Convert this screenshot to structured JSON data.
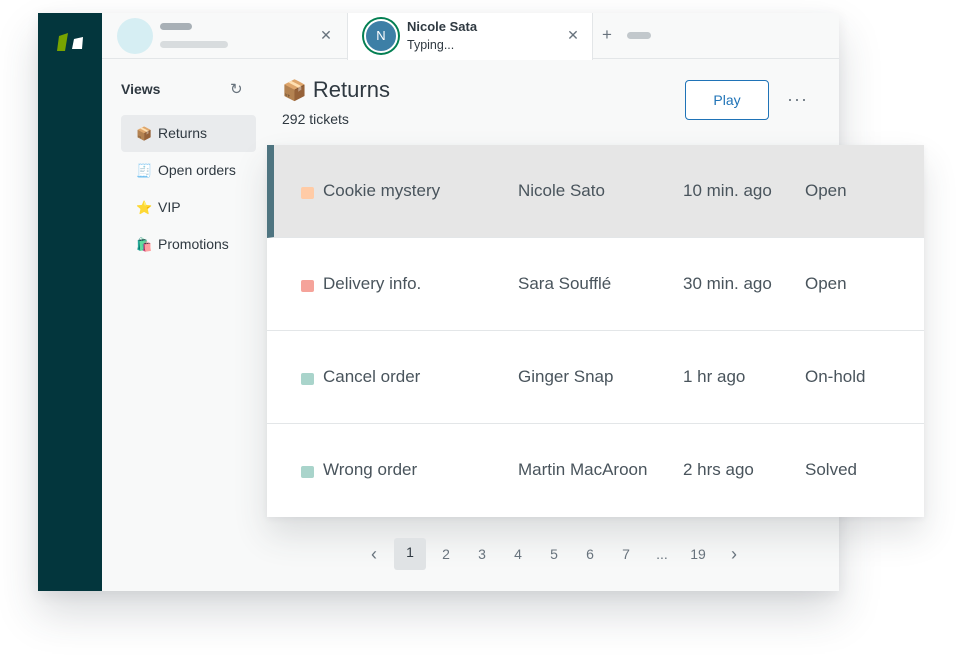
{
  "tabs": [
    {
      "placeholder": true
    },
    {
      "avatar_initial": "N",
      "name": "Nicole Sata",
      "status": "Typing..."
    }
  ],
  "sidebar": {
    "title": "Views",
    "items": [
      {
        "emoji": "📦",
        "label": "Returns",
        "active": true
      },
      {
        "emoji": "🧾",
        "label": "Open orders",
        "active": false
      },
      {
        "emoji": "⭐",
        "label": "VIP",
        "active": false
      },
      {
        "emoji": "🛍️",
        "label": "Promotions",
        "active": false
      }
    ]
  },
  "main": {
    "title_emoji": "📦",
    "title": "Returns",
    "ticket_count": "292 tickets",
    "play_label": "Play",
    "more_label": "···"
  },
  "tickets": [
    {
      "subject": "Cookie mystery",
      "requester": "Nicole Sato",
      "updated": "10 min. ago",
      "status": "Open",
      "priority_color": "#ffcba6",
      "selected": true
    },
    {
      "subject": "Delivery info.",
      "requester": "Sara Soufflé",
      "updated": "30 min. ago",
      "status": "Open",
      "priority_color": "#f5a39a",
      "selected": false
    },
    {
      "subject": "Cancel order",
      "requester": "Ginger Snap",
      "updated": "1 hr ago",
      "status": "On-hold",
      "priority_color": "#a9d4cb",
      "selected": false
    },
    {
      "subject": "Wrong order",
      "requester": "Martin MacAroon",
      "updated": "2 hrs ago",
      "status": "Solved",
      "priority_color": "#a9d4cb",
      "selected": false
    }
  ],
  "pagination": {
    "prev": "‹",
    "pages": [
      "1",
      "2",
      "3",
      "4",
      "5",
      "6",
      "7",
      "...",
      "19"
    ],
    "current": "1",
    "next": "›"
  },
  "colors": {
    "rail": "#03363d",
    "accent": "#1f73b7",
    "selected_row": "#e6e6e6"
  }
}
